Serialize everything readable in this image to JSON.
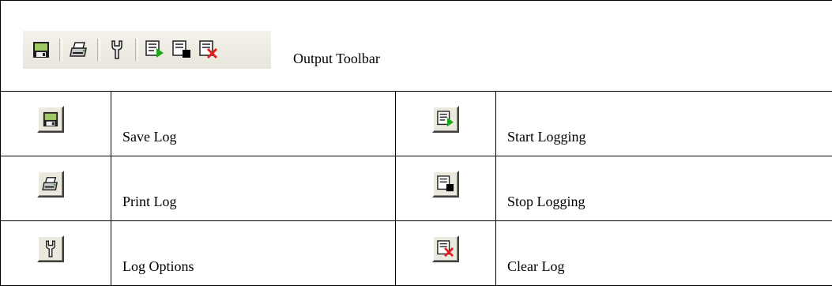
{
  "toolbar": {
    "caption": "Output Toolbar",
    "icons": [
      "save-log-icon",
      "print-log-icon",
      "log-options-icon",
      "start-logging-icon",
      "stop-logging-icon",
      "clear-log-icon"
    ]
  },
  "rows": [
    {
      "left_icon": "save-log-icon",
      "left_label": "Save Log",
      "right_icon": "start-logging-icon",
      "right_label": "Start Logging"
    },
    {
      "left_icon": "print-log-icon",
      "left_label": "Print Log",
      "right_icon": "stop-logging-icon",
      "right_label": "Stop Logging"
    },
    {
      "left_icon": "log-options-icon",
      "left_label": "Log Options",
      "right_icon": "clear-log-icon",
      "right_label": "Clear Log"
    }
  ],
  "colors": {
    "disk_green": "#a0c864",
    "arrow_green": "#1aa81a",
    "clear_red": "#e02020",
    "button_face": "#ebe8dd"
  }
}
